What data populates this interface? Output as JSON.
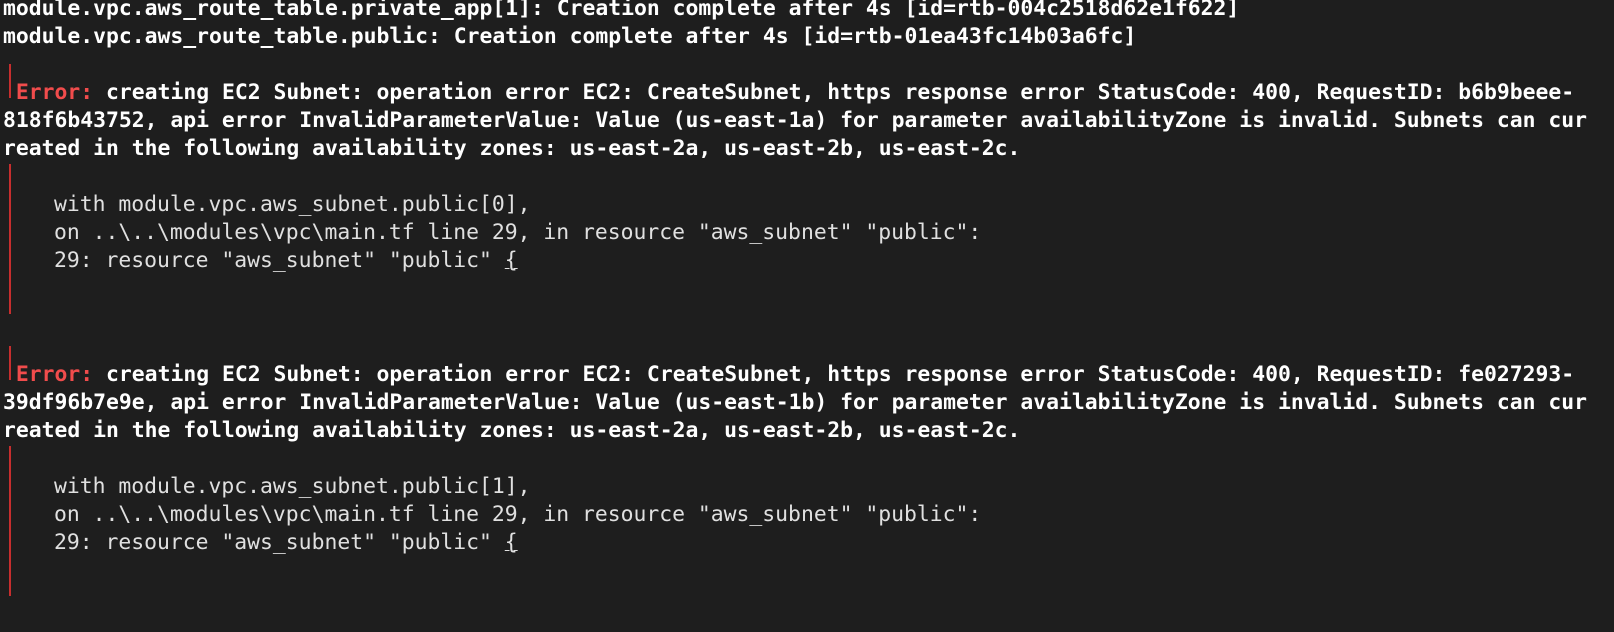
{
  "terminal": {
    "lines": {
      "l1": "module.vpc.aws_route_table.private_app[1]: Creation complete after 4s [id=rtb-004c2518d62e1f622]",
      "l2": "module.vpc.aws_route_table.public: Creation complete after 4s [id=rtb-01ea43fc14b03a6fc]"
    },
    "errors": [
      {
        "label": "Error:",
        "message_line1": " creating EC2 Subnet: operation error EC2: CreateSubnet, https response error StatusCode: 400, RequestID: b6b9beee-",
        "message_line2": "818f6b43752, api error InvalidParameterValue: Value (us-east-1a) for parameter availabilityZone is invalid. Subnets can cur",
        "message_line3": "reated in the following availability zones: us-east-2a, us-east-2b, us-east-2c.",
        "with": "with module.vpc.aws_subnet.public[0],",
        "on": "on ..\\..\\modules\\vpc\\main.tf line 29, in resource \"aws_subnet\" \"public\":",
        "code_prefix": "29: resource \"aws_subnet\" \"public\" ",
        "code_brace": "{"
      },
      {
        "label": "Error:",
        "message_line1": " creating EC2 Subnet: operation error EC2: CreateSubnet, https response error StatusCode: 400, RequestID: fe027293-",
        "message_line2": "39df96b7e9e, api error InvalidParameterValue: Value (us-east-1b) for parameter availabilityZone is invalid. Subnets can cur",
        "message_line3": "reated in the following availability zones: us-east-2a, us-east-2b, us-east-2c.",
        "with": "with module.vpc.aws_subnet.public[1],",
        "on": "on ..\\..\\modules\\vpc\\main.tf line 29, in resource \"aws_subnet\" \"public\":",
        "code_prefix": "29: resource \"aws_subnet\" \"public\" ",
        "code_brace": "{"
      }
    ],
    "colors": {
      "background": "#1e1e1e",
      "error_label": "#f14c4c",
      "gutter": "#c72e2e",
      "text": "#ffffff"
    }
  }
}
